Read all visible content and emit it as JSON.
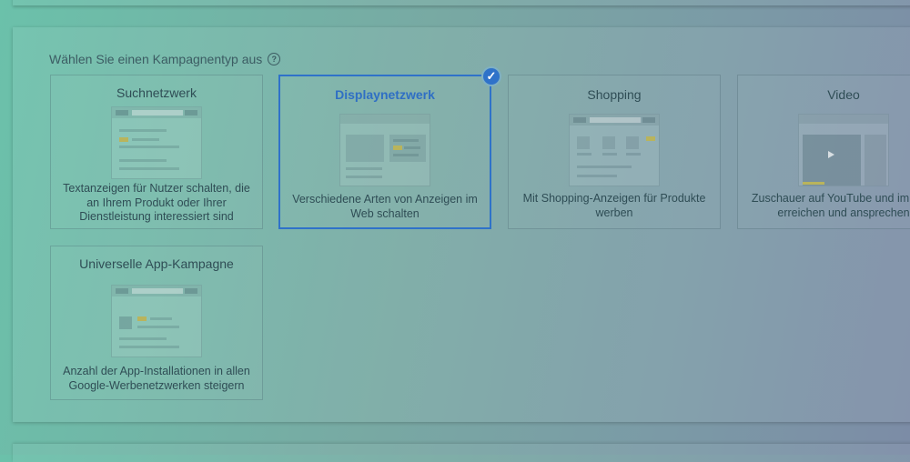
{
  "section": {
    "label": "Wählen Sie einen Kampagnentyp aus"
  },
  "cards": [
    {
      "title": "Suchnetzwerk",
      "description": "Textanzeigen für Nutzer schalten, die an Ihrem Produkt oder Ihrer Dienstleistung interessiert sind"
    },
    {
      "title": "Displaynetzwerk",
      "description": "Verschiedene Arten von Anzeigen im Web schalten"
    },
    {
      "title": "Shopping",
      "description": "Mit Shopping-Anzeigen für Produkte werben"
    },
    {
      "title": "Video",
      "description": "Zuschauer auf YouTube und im Web erreichen und ansprechen"
    },
    {
      "title": "Universelle App-Kampagne",
      "description": "Anzahl der App-Installationen in allen Google-Werbenetzwerken steigern"
    }
  ],
  "selected_card": "Displaynetzwerk",
  "colors": {
    "accent": "#2f72c9",
    "highlight": "#b9b45c"
  },
  "icons": {
    "help": "help-circle-icon",
    "check": "check-circle-icon"
  }
}
